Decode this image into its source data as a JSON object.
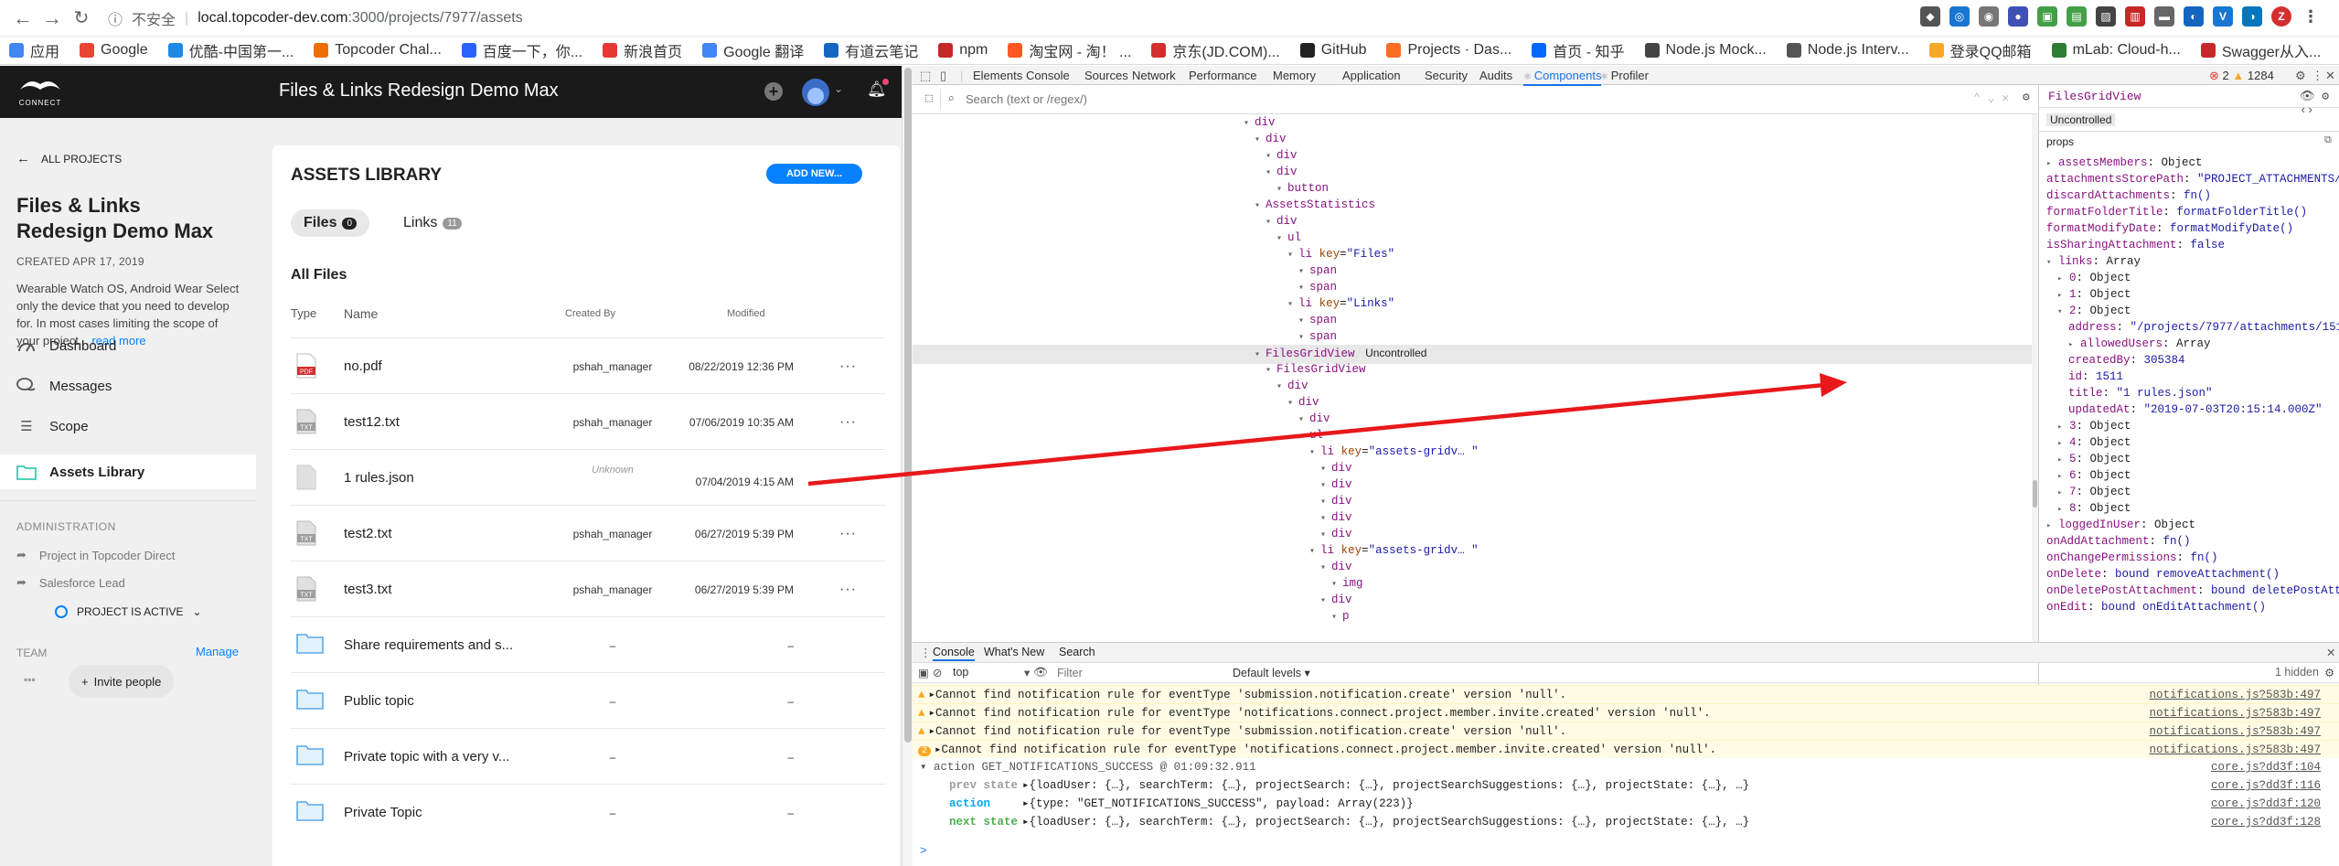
{
  "browser": {
    "security": "不安全",
    "host": "local.topcoder-dev.com",
    "path": ":3000/projects/7977/assets",
    "bookmarks": [
      {
        "label": "应用",
        "color": "#4285f4"
      },
      {
        "label": "Google",
        "color": "#ea4335"
      },
      {
        "label": "优酷-中国第一...",
        "color": "#1e88e5"
      },
      {
        "label": "Topcoder Chal...",
        "color": "#ef6c00"
      },
      {
        "label": "百度一下，你...",
        "color": "#2962ff"
      },
      {
        "label": "新浪首页",
        "color": "#e53935"
      },
      {
        "label": "Google 翻译",
        "color": "#4285f4"
      },
      {
        "label": "有道云笔记",
        "color": "#1565c0"
      },
      {
        "label": "npm",
        "color": "#c62828"
      },
      {
        "label": "淘宝网 - 淘！ ...",
        "color": "#ff5722"
      },
      {
        "label": "京东(JD.COM)...",
        "color": "#d32f2f"
      },
      {
        "label": "GitHub",
        "color": "#222222"
      },
      {
        "label": "Projects · Das...",
        "color": "#fc6d26"
      },
      {
        "label": "首页 - 知乎",
        "color": "#0066ff"
      },
      {
        "label": "Node.js Mock...",
        "color": "#444444"
      },
      {
        "label": "Node.js Interv...",
        "color": "#555555"
      },
      {
        "label": "登录QQ邮箱",
        "color": "#f9a825"
      },
      {
        "label": "mLab: Cloud-h...",
        "color": "#2e7d32"
      },
      {
        "label": "Swagger从入...",
        "color": "#c62828"
      }
    ],
    "profile_initial": "Z"
  },
  "app": {
    "logo_text": "CONNECT",
    "header_title": "Files & Links Redesign Demo Max",
    "back_label": "ALL PROJECTS",
    "project": {
      "title": "Files & Links Redesign Demo Max",
      "created": "CREATED APR 17, 2019",
      "description": "Wearable Watch OS, Android Wear Select only the device that you need to develop for. In most cases limiting the scope of your project...",
      "read_more": "read more"
    },
    "nav": {
      "dashboard": "Dashboard",
      "messages": "Messages",
      "scope": "Scope",
      "assets": "Assets Library"
    },
    "admin": {
      "heading": "ADMINISTRATION",
      "item1": "Project in Topcoder Direct",
      "item2": "Salesforce Lead",
      "status": "PROJECT IS ACTIVE"
    },
    "team": {
      "heading": "TEAM",
      "manage": "Manage",
      "invite": "Invite people"
    },
    "library": {
      "title": "ASSETS LIBRARY",
      "add_button": "ADD NEW...",
      "tab_files": "Files",
      "files_count": "0",
      "tab_links": "Links",
      "links_count": "11",
      "section": "All Files",
      "col_type": "Type",
      "col_name": "Name",
      "col_created": "Created By",
      "col_modified": "Modified",
      "rows": [
        {
          "type": "pdf",
          "name": "no.pdf",
          "by": "pshah_manager",
          "modified": "08/22/2019 12:36 PM",
          "more": "···"
        },
        {
          "type": "txt",
          "name": "test12.txt",
          "by": "pshah_manager",
          "modified": "07/06/2019 10:35 AM",
          "more": "···"
        },
        {
          "type": "doc",
          "name": "1 rules.json",
          "by": "Unknown",
          "modified": "07/04/2019 4:15 AM",
          "more": ""
        },
        {
          "type": "txt",
          "name": "test2.txt",
          "by": "pshah_manager",
          "modified": "06/27/2019 5:39 PM",
          "more": "···"
        },
        {
          "type": "txt",
          "name": "test3.txt",
          "by": "pshah_manager",
          "modified": "06/27/2019 5:39 PM",
          "more": "···"
        },
        {
          "type": "folder",
          "name": "Share requirements and s...",
          "by": "–",
          "modified": "–",
          "more": ""
        },
        {
          "type": "folder",
          "name": "Public topic",
          "by": "–",
          "modified": "–",
          "more": ""
        },
        {
          "type": "folder",
          "name": "Private topic with a very v...",
          "by": "–",
          "modified": "–",
          "more": ""
        },
        {
          "type": "folder",
          "name": "Private Topic",
          "by": "–",
          "modified": "–",
          "more": ""
        }
      ],
      "file_badge_pdf": "PDF",
      "file_badge_txt": "TXT"
    }
  },
  "devtools": {
    "tabs": [
      "Elements",
      "Console",
      "Sources",
      "Network",
      "Performance",
      "Memory",
      "Application",
      "Security",
      "Audits",
      "Components",
      "Profiler"
    ],
    "error_count": "2",
    "warn_count": "1284",
    "search_placeholder": "Search (text or /regex/)",
    "tree": [
      {
        "indent": 0,
        "text": "div",
        "kind": "tag"
      },
      {
        "indent": 1,
        "text": "div",
        "kind": "tag"
      },
      {
        "indent": 2,
        "text": "div",
        "kind": "tag"
      },
      {
        "indent": 2,
        "text": "div",
        "kind": "tag"
      },
      {
        "indent": 3,
        "text": "button",
        "kind": "tag"
      },
      {
        "indent": 1,
        "text": "AssetsStatistics",
        "kind": "cmp"
      },
      {
        "indent": 2,
        "text": "div",
        "kind": "tag"
      },
      {
        "indent": 3,
        "text": "ul",
        "kind": "tag"
      },
      {
        "indent": 4,
        "text": "li",
        "kind": "tag",
        "key": "\"Files\""
      },
      {
        "indent": 5,
        "text": "span",
        "kind": "tag"
      },
      {
        "indent": 5,
        "text": "span",
        "kind": "tag"
      },
      {
        "indent": 4,
        "text": "li",
        "kind": "tag",
        "key": "\"Links\""
      },
      {
        "indent": 5,
        "text": "span",
        "kind": "tag"
      },
      {
        "indent": 5,
        "text": "span",
        "kind": "tag"
      },
      {
        "indent": 1,
        "text": "FilesGridView",
        "kind": "cmp",
        "badge": "Uncontrolled",
        "selected": true
      },
      {
        "indent": 2,
        "text": "FilesGridView",
        "kind": "cmp"
      },
      {
        "indent": 3,
        "text": "div",
        "kind": "tag"
      },
      {
        "indent": 4,
        "text": "div",
        "kind": "tag"
      },
      {
        "indent": 5,
        "text": "div",
        "kind": "tag"
      },
      {
        "indent": 5,
        "text": "ul",
        "kind": "tag"
      },
      {
        "indent": 6,
        "text": "li",
        "kind": "tag",
        "key": "\"assets-gridv… \""
      },
      {
        "indent": 7,
        "text": "div",
        "kind": "tag"
      },
      {
        "indent": 7,
        "text": "div",
        "kind": "tag"
      },
      {
        "indent": 7,
        "text": "div",
        "kind": "tag"
      },
      {
        "indent": 7,
        "text": "div",
        "kind": "tag"
      },
      {
        "indent": 7,
        "text": "div",
        "kind": "tag"
      },
      {
        "indent": 6,
        "text": "li",
        "kind": "tag",
        "key": "\"assets-gridv… \""
      },
      {
        "indent": 7,
        "text": "div",
        "kind": "tag"
      },
      {
        "indent": 8,
        "text": "img",
        "kind": "tag"
      },
      {
        "indent": 7,
        "text": "div",
        "kind": "tag"
      },
      {
        "indent": 8,
        "text": "p",
        "kind": "tag"
      }
    ],
    "props_title": "FilesGridView",
    "props_badge": "Uncontrolled",
    "props_label": "props",
    "props": [
      {
        "i": 0,
        "k": "assetsMembers",
        "v": "Object",
        "t": "plain"
      },
      {
        "i": 0,
        "k": "attachmentsStorePath",
        "v": "\"PROJECT_ATTACHMENTS/7977/\"",
        "t": "str"
      },
      {
        "i": 0,
        "k": "discardAttachments",
        "v": "fn()",
        "t": "fn"
      },
      {
        "i": 0,
        "k": "formatFolderTitle",
        "v": "formatFolderTitle()",
        "t": "fn"
      },
      {
        "i": 0,
        "k": "formatModifyDate",
        "v": "formatModifyDate()",
        "t": "fn"
      },
      {
        "i": 0,
        "k": "isSharingAttachment",
        "v": "false",
        "t": "str"
      },
      {
        "i": 0,
        "k": "links",
        "v": "Array",
        "t": "plain"
      },
      {
        "i": 1,
        "k": "0",
        "v": "Object",
        "t": "plain"
      },
      {
        "i": 1,
        "k": "1",
        "v": "Object",
        "t": "plain"
      },
      {
        "i": 1,
        "k": "2",
        "v": "Object",
        "t": "plain"
      },
      {
        "i": 2,
        "k": "address",
        "v": "\"/projects/7977/attachments/1511\"",
        "t": "str"
      },
      {
        "i": 2,
        "k": "allowedUsers",
        "v": "Array",
        "t": "plain"
      },
      {
        "i": 2,
        "k": "createdBy",
        "v": "305384",
        "t": "str"
      },
      {
        "i": 2,
        "k": "id",
        "v": "1511",
        "t": "str"
      },
      {
        "i": 2,
        "k": "title",
        "v": "\"1 rules.json\"",
        "t": "str"
      },
      {
        "i": 2,
        "k": "updatedAt",
        "v": "\"2019-07-03T20:15:14.000Z\"",
        "t": "str"
      },
      {
        "i": 1,
        "k": "3",
        "v": "Object",
        "t": "plain"
      },
      {
        "i": 1,
        "k": "4",
        "v": "Object",
        "t": "plain"
      },
      {
        "i": 1,
        "k": "5",
        "v": "Object",
        "t": "plain"
      },
      {
        "i": 1,
        "k": "6",
        "v": "Object",
        "t": "plain"
      },
      {
        "i": 1,
        "k": "7",
        "v": "Object",
        "t": "plain"
      },
      {
        "i": 1,
        "k": "8",
        "v": "Object",
        "t": "plain"
      },
      {
        "i": 0,
        "k": "loggedInUser",
        "v": "Object",
        "t": "plain"
      },
      {
        "i": 0,
        "k": "onAddAttachment",
        "v": "fn()",
        "t": "fn"
      },
      {
        "i": 0,
        "k": "onChangePermissions",
        "v": "fn()",
        "t": "fn"
      },
      {
        "i": 0,
        "k": "onDelete",
        "v": "bound removeAttachment()",
        "t": "fn"
      },
      {
        "i": 0,
        "k": "onDeletePostAttachment",
        "v": "bound deletePostAttachment()",
        "t": "fn"
      },
      {
        "i": 0,
        "k": "onEdit",
        "v": "bound onEditAttachment()",
        "t": "fn"
      }
    ],
    "drawer_tabs": [
      "Console",
      "What's New",
      "Search"
    ],
    "console_context": "top",
    "console_filter": "Filter",
    "console_levels": "Default levels ▾",
    "console_hidden": "1 hidden",
    "console_lines": [
      {
        "kind": "warn",
        "text": "▸Cannot find notification rule for eventType 'submission.notification.create' version 'null'.",
        "src": "notifications.js?583b:497"
      },
      {
        "kind": "warn",
        "text": "▸Cannot find notification rule for eventType 'notifications.connect.project.member.invite.created' version 'null'.",
        "src": "notifications.js?583b:497"
      },
      {
        "kind": "warn",
        "text": "▸Cannot find notification rule for eventType 'submission.notification.create' version 'null'.",
        "src": "notifications.js?583b:497"
      },
      {
        "kind": "warn2",
        "text": "▸Cannot find notification rule for eventType 'notifications.connect.project.member.invite.created' version 'null'.",
        "src": "notifications.js?583b:497"
      },
      {
        "kind": "group",
        "text": "▾  action GET_NOTIFICATIONS_SUCCESS @ 01:09:32.911",
        "src": "core.js?dd3f:104"
      },
      {
        "kind": "state",
        "label": "prev state",
        "text": "▸{loadUser: {…}, searchTerm: {…}, projectSearch: {…}, projectSearchSuggestions: {…}, projectState: {…}, …}",
        "src": "core.js?dd3f:116"
      },
      {
        "kind": "action",
        "label": "action",
        "text": "▸{type: \"GET_NOTIFICATIONS_SUCCESS\", payload: Array(223)}",
        "src": "core.js?dd3f:120"
      },
      {
        "kind": "next",
        "label": "next state",
        "text": "▸{loadUser: {…}, searchTerm: {…}, projectSearch: {…}, projectSearchSuggestions: {…}, projectState: {…}, …}",
        "src": "core.js?dd3f:128"
      }
    ],
    "prompt": ">"
  },
  "colors": {
    "accent_blue": "#0681ff",
    "annotation_red": "#e8181b",
    "active_green": "#38c9b3"
  }
}
